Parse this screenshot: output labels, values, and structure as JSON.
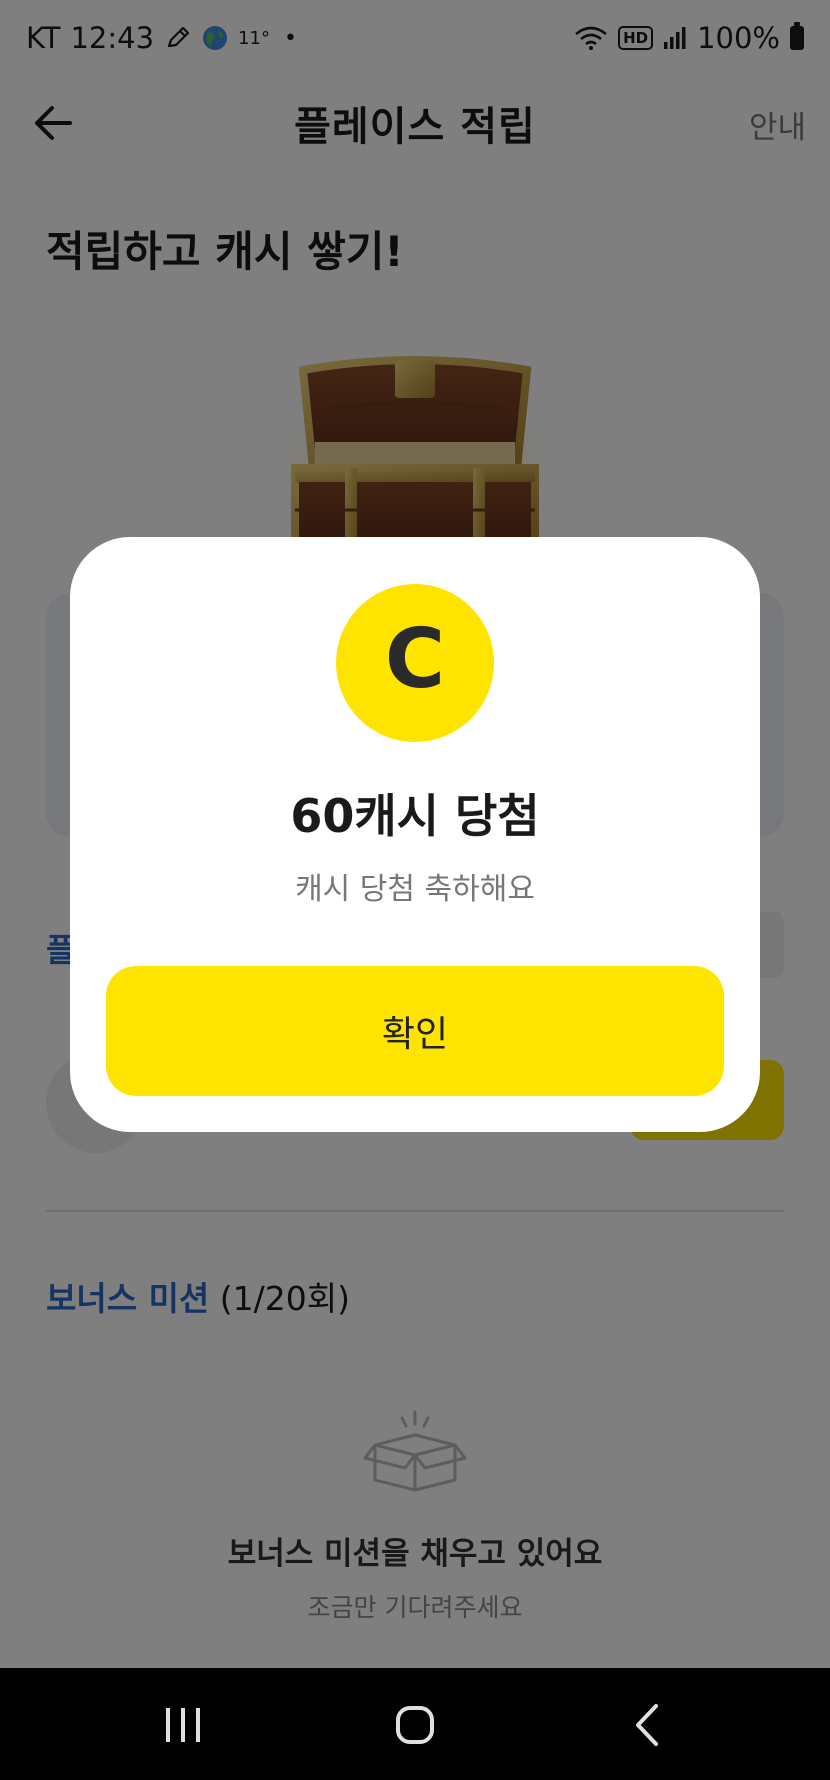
{
  "status_bar": {
    "carrier": "KT",
    "time": "12:43",
    "temperature": "11°",
    "dot": "•",
    "hd_label": "HD",
    "battery": "100%",
    "icons": [
      "pen-icon",
      "globe-icon",
      "wifi-icon",
      "signal-icon",
      "battery-icon"
    ]
  },
  "header": {
    "title": "플레이스 적립",
    "guide": "안내"
  },
  "hero": {
    "title": "적립하고 캐시 쌓기!"
  },
  "background": {
    "section_stub": "플"
  },
  "bonus": {
    "title": "보너스 미션",
    "count": "(1/20회)",
    "empty_title": "보너스 미션을 채우고 있어요",
    "empty_sub": "조금만 기다려주세요"
  },
  "modal": {
    "coin_letter": "C",
    "title": "60캐시 당첨",
    "subtitle": "캐시 당첨 축하해요",
    "confirm": "확인"
  },
  "colors": {
    "accent_yellow": "#ffe400",
    "link_blue": "#2a68c9",
    "overlay": "rgba(0,0,0,0.5)"
  }
}
